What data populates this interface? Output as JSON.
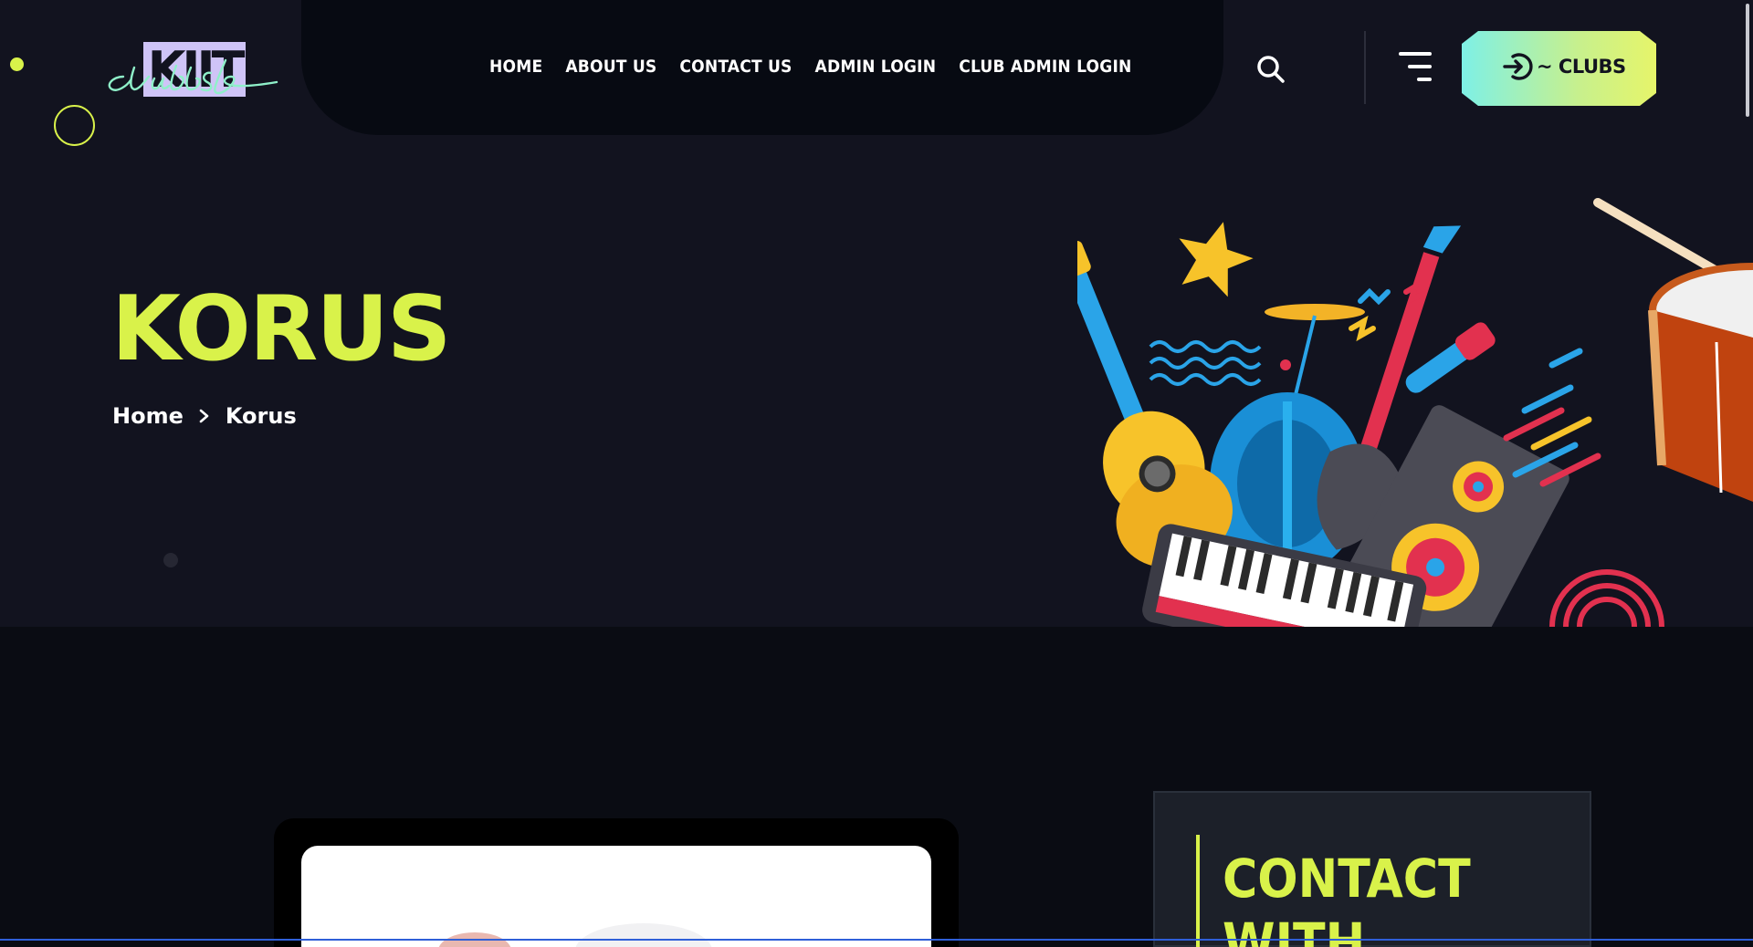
{
  "nav": {
    "links": [
      "HOME",
      "ABOUT US",
      "CONTACT US",
      "ADMIN LOGIN",
      "CLUB ADMIN LOGIN"
    ]
  },
  "logo": {
    "text": "KIIT",
    "script": "clubs"
  },
  "header": {
    "clubs_button": "~ CLUBS"
  },
  "icons": {
    "search": "search-icon",
    "menu": "menu-icon",
    "login": "login-arrow-icon",
    "breadcrumb_sep": "chevron-right-icon"
  },
  "hero": {
    "title": "KORUS",
    "breadcrumb": [
      "Home",
      "Korus"
    ]
  },
  "contact": {
    "title": "CONTACT\nWITH"
  },
  "colors": {
    "accent": "#d9f24a",
    "background": "#12131f",
    "nav_bg": "#070a12"
  }
}
